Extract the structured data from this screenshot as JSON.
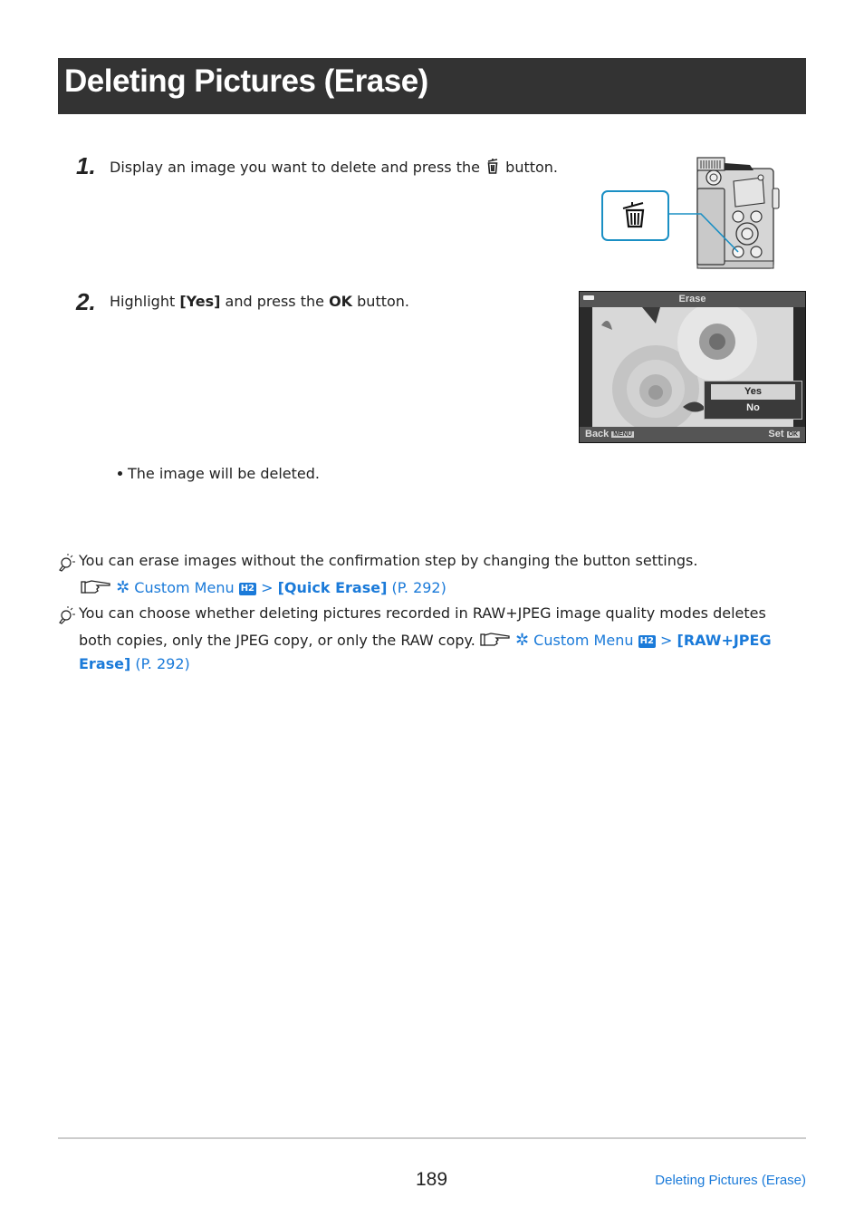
{
  "page": {
    "title": "Deleting Pictures (Erase)"
  },
  "steps": [
    {
      "number": "1.",
      "text_before_icon": "Display an image you want to delete and press the",
      "icon": "trash-icon",
      "text_after_icon": "button."
    },
    {
      "number": "2.",
      "text_part1": "Highlight ",
      "bold_yes": "[Yes]",
      "text_part2": " and press the ",
      "bold_ok": "OK",
      "text_part3": " button."
    }
  ],
  "camera_illustration": {
    "callout_icon": "trash-icon"
  },
  "lcd_screen": {
    "title": "Erase",
    "battery_icon": "battery-icon",
    "options": [
      "Yes",
      "No"
    ],
    "selected_option": "Yes",
    "back_label": "Back",
    "back_key": "MENU",
    "set_label": "Set",
    "set_key": "OK"
  },
  "result_bullet": "The image will be deleted.",
  "tips": [
    {
      "icon": "lightbulb-tip-icon",
      "text": "You can erase images without the confirmation step by changing the button settings.",
      "ref_icon": "pointing-hand-icon",
      "menu_icon": "gear-icon",
      "menu_label": "Custom Menu",
      "menu_badge": "H2",
      "separator": ">",
      "item": "[Quick Erase]",
      "page_ref": "(P. 292)"
    },
    {
      "icon": "lightbulb-tip-icon",
      "text_line1": "You can choose whether deleting pictures recorded in RAW+JPEG image quality modes deletes",
      "text_line2": "both copies, only the JPEG copy, or only the RAW copy.",
      "ref_icon": "pointing-hand-icon",
      "menu_icon": "gear-icon",
      "menu_label": "Custom Menu",
      "menu_badge": "H2",
      "separator": ">",
      "item_part1": "[RAW+JPEG",
      "item_part2": "Erase]",
      "page_ref": "(P. 292)"
    }
  ],
  "footer": {
    "page_number": "189",
    "section_link": "Deleting Pictures (Erase)"
  },
  "colors": {
    "title_bar": "#333333",
    "link": "#1a7ad9",
    "callout": "#1a8fc4"
  }
}
